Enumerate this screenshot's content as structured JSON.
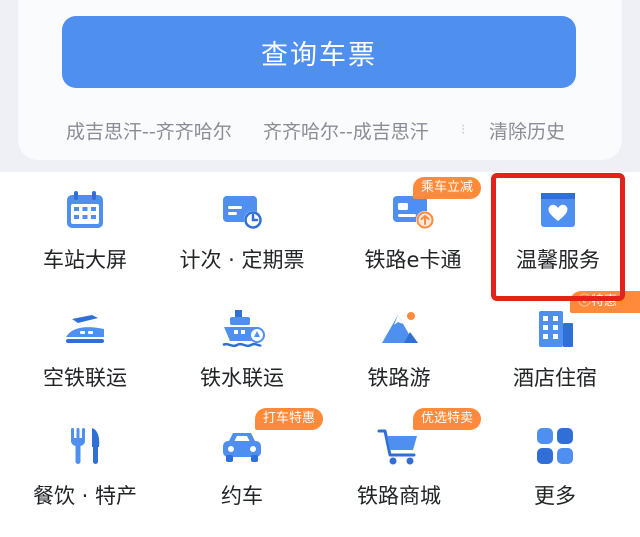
{
  "query": {
    "label": "查询车票"
  },
  "history": {
    "items": [
      "成吉思汗--齐齐哈尔",
      "齐齐哈尔--成吉思汗"
    ],
    "separator": "⁝",
    "clear_label": "清除历史"
  },
  "services": [
    {
      "label": "车站大屏",
      "icon": "station-screen-icon"
    },
    {
      "label": "计次 · 定期票",
      "icon": "ticket-clock-icon"
    },
    {
      "label": "铁路e卡通",
      "icon": "rail-ecard-icon",
      "badge": "乘车立减"
    },
    {
      "label": "温馨服务",
      "icon": "care-service-icon",
      "highlighted": true
    },
    {
      "label": "空铁联运",
      "icon": "air-rail-icon"
    },
    {
      "label": "铁水联运",
      "icon": "rail-ship-icon"
    },
    {
      "label": "铁路游",
      "icon": "rail-travel-icon"
    },
    {
      "label": "酒店住宿",
      "icon": "hotel-icon",
      "badge": "ⓔ特惠"
    },
    {
      "label": "餐饮 · 特产",
      "icon": "dining-icon"
    },
    {
      "label": "约车",
      "icon": "car-icon",
      "badge": "打车特惠"
    },
    {
      "label": "铁路商城",
      "icon": "shopping-cart-icon",
      "badge": "优选特卖"
    },
    {
      "label": "更多",
      "icon": "more-grid-icon"
    }
  ],
  "colors": {
    "primary": "#4e8fef",
    "badge": "#ff8a3c",
    "highlight": "#e3221c"
  }
}
